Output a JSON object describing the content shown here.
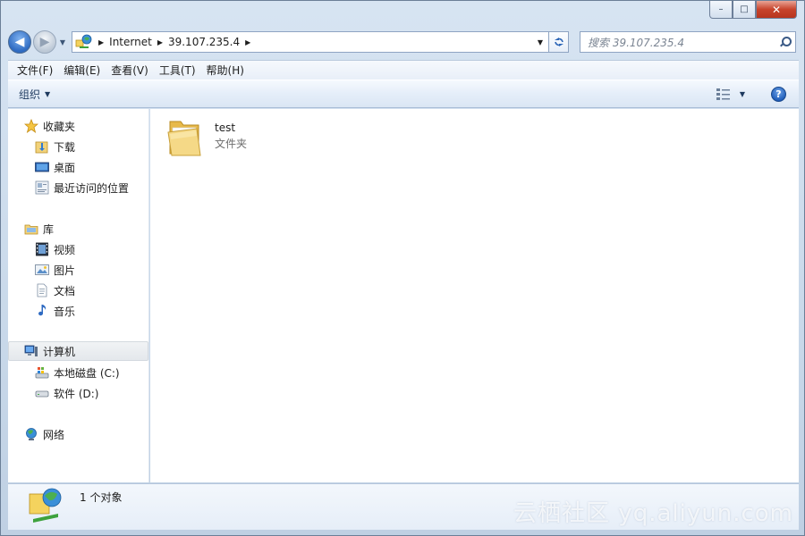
{
  "window": {
    "caption_buttons": {
      "minimize": "–",
      "maximize": "□",
      "close": "✕"
    }
  },
  "navigation": {
    "back_glyph": "◀",
    "forward_glyph": "▶",
    "breadcrumbs": [
      "Internet",
      "39.107.235.4"
    ],
    "search_placeholder": "搜索 39.107.235.4"
  },
  "menu": {
    "items": [
      "文件(F)",
      "编辑(E)",
      "查看(V)",
      "工具(T)",
      "帮助(H)"
    ]
  },
  "toolbar": {
    "organize_label": "组织",
    "help_glyph": "?"
  },
  "sidebar": {
    "favorites": {
      "header": "收藏夹",
      "items": [
        "下载",
        "桌面",
        "最近访问的位置"
      ]
    },
    "libraries": {
      "header": "库",
      "items": [
        "视频",
        "图片",
        "文档",
        "音乐"
      ]
    },
    "computer": {
      "header": "计算机",
      "items": [
        "本地磁盘 (C:)",
        "软件 (D:)"
      ]
    },
    "network": {
      "header": "网络"
    }
  },
  "content": {
    "items": [
      {
        "name": "test",
        "type": "文件夹"
      }
    ]
  },
  "details": {
    "count_text": "1 个对象"
  },
  "watermark": "云栖社区 yq.aliyun.com",
  "colors": {
    "accent": "#2f6bc2",
    "folder": "#f2d27a",
    "frame": "#c9d9ea"
  }
}
